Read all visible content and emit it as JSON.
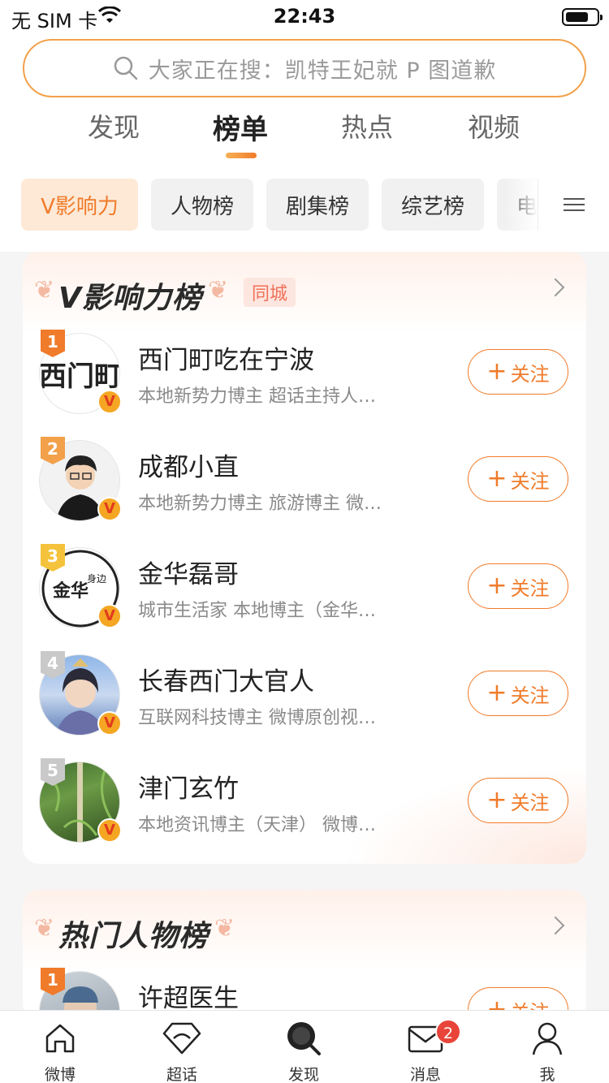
{
  "status": {
    "carrier": "无 SIM 卡",
    "time": "22:43"
  },
  "search": {
    "placeholder": "大家正在搜：凯特王妃就 P 图道歉"
  },
  "tabs": [
    {
      "label": "发现"
    },
    {
      "label": "榜单"
    },
    {
      "label": "热点"
    },
    {
      "label": "视频"
    }
  ],
  "chips": [
    {
      "label": "V影响力"
    },
    {
      "label": "人物榜"
    },
    {
      "label": "剧集榜"
    },
    {
      "label": "综艺榜"
    },
    {
      "label": "电"
    }
  ],
  "card_v": {
    "title": "V影响力榜",
    "city_badge": "同城",
    "rows": [
      {
        "rank": "1",
        "name": "西门町吃在宁波",
        "desc": "本地新势力博主 超话主持人…",
        "follow": "关注"
      },
      {
        "rank": "2",
        "name": "成都小直",
        "desc": "本地新势力博主 旅游博主 微…",
        "follow": "关注"
      },
      {
        "rank": "3",
        "name": "金华磊哥",
        "desc": "城市生活家 本地博主（金华…",
        "follow": "关注"
      },
      {
        "rank": "4",
        "name": "长春西门大官人",
        "desc": "互联网科技博主 微博原创视…",
        "follow": "关注"
      },
      {
        "rank": "5",
        "name": "津门玄竹",
        "desc": "本地资讯博主（天津） 微博…",
        "follow": "关注"
      }
    ]
  },
  "card_hot": {
    "title": "热门人物榜",
    "rows": [
      {
        "rank": "1",
        "name": "许超医生",
        "follow": "关注"
      }
    ]
  },
  "tabbar": [
    {
      "label": "微博",
      "icon": "home-icon"
    },
    {
      "label": "超话",
      "icon": "diamond-icon"
    },
    {
      "label": "发现",
      "icon": "discover-icon"
    },
    {
      "label": "消息",
      "icon": "mail-icon",
      "badge": "2"
    },
    {
      "label": "我",
      "icon": "profile-icon"
    }
  ],
  "avatar_texts": {
    "a1": "西门町",
    "a3_main": "金华",
    "a3_side": "身边"
  },
  "colors": {
    "accent": "#f07b2a",
    "search_border": "#f2a14a",
    "badge_red": "#e8443a"
  }
}
